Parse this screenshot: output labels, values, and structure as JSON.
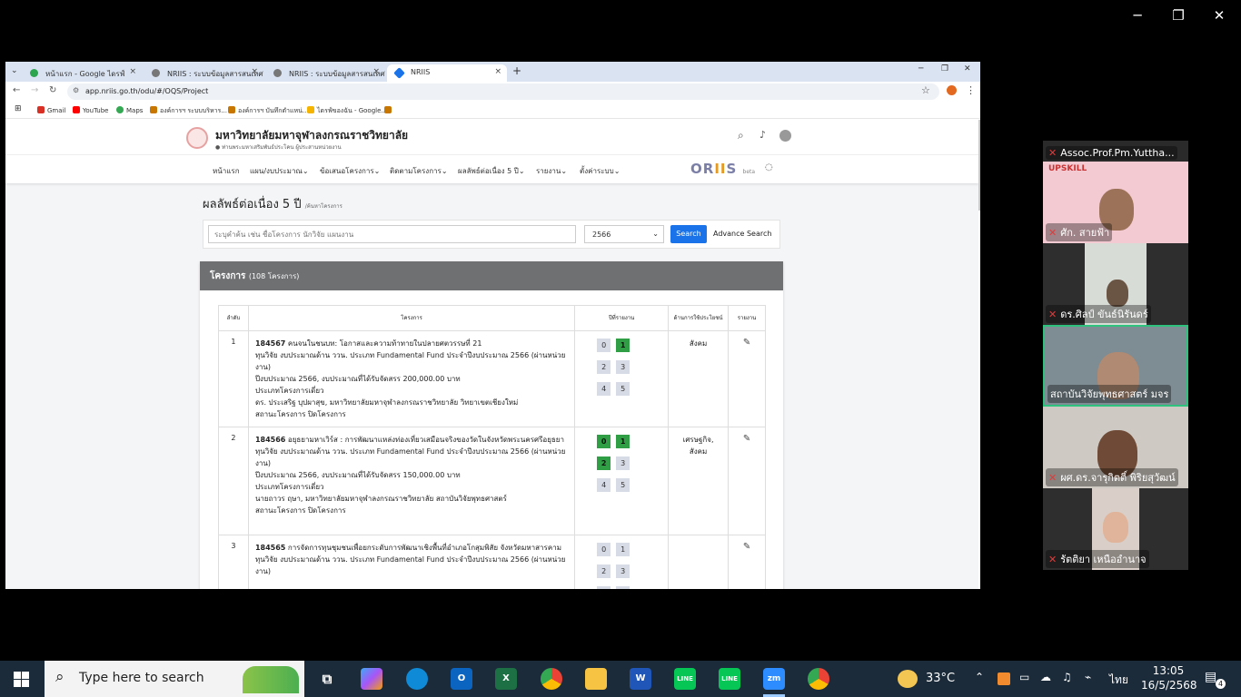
{
  "window_controls": {
    "minimize": "─",
    "restore": "❐",
    "close": "✕"
  },
  "browser": {
    "tabs": [
      {
        "title": "หน้าแรก - Google ไดรฟ์",
        "close": "×",
        "color": "#2da44e"
      },
      {
        "title": "NRIIS : ระบบข้อมูลสารสนเทศวิจัยและ...",
        "close": "×",
        "color": "#555"
      },
      {
        "title": "NRIIS : ระบบข้อมูลสารสนเทศวิจัยและ...",
        "close": "×",
        "color": "#555"
      },
      {
        "title": "NRIIS",
        "close": "×",
        "color": "#1a73e8"
      }
    ],
    "new_tab": "+",
    "tab_menu": "⌄",
    "url": "app.nriis.go.th/odu/#/OQS/Project",
    "bookmarks": [
      {
        "label": "Gmail",
        "color": "#d93025"
      },
      {
        "label": "YouTube",
        "color": "#ff0000"
      },
      {
        "label": "Maps",
        "color": "#34a853"
      },
      {
        "label": "องค์การฯ ระบบบริหาร...",
        "color": "#c77700"
      },
      {
        "label": "องค์การฯ บันทึกตำแหน่...",
        "color": "#c77700"
      },
      {
        "label": "ไดรฟ์ของฉัน - Google...",
        "color": "#f4b400"
      },
      {
        "label": "",
        "color": "#c77700"
      }
    ]
  },
  "site": {
    "university": "มหาวิทยาลัยมหาจุฬาลงกรณราชวิทยาลัย",
    "user_note": "ท่านพระมหาเสริมพันธ์ประโคน ผู้ประสานหน่วยงาน",
    "nav": [
      "หน้าแรก",
      "แผน/งบประมาณ",
      "ข้อเสนอโครงการ",
      "ติดตามโครงการ",
      "ผลลัพธ์ต่อเนื่อง 5 ปี",
      "รายงาน",
      "ตั้งค่าระบบ"
    ],
    "brand": {
      "a": "OR",
      "b": "II",
      "c": "S",
      "beta": "beta"
    },
    "page_title": "ผลลัพธ์ต่อเนื่อง 5 ปี",
    "page_sub": "/ค้นหาโครงการ",
    "search": {
      "placeholder": "ระบุคำค้น เช่น ชื่อโครงการ นักวิจัย แผนงาน",
      "year": "2566",
      "button": "Search",
      "advance": "Advance Search"
    },
    "panel": {
      "title": "โครงการ",
      "count": "(108 โครงการ)"
    },
    "table": {
      "headers": {
        "no": "ลำดับ",
        "project": "โครงการ",
        "year": "ปีที่รายงาน",
        "benefit": "ด้านการใช้ประโยชน์",
        "report": "รายงาน"
      },
      "rows": [
        {
          "no": "1",
          "code": "184567",
          "title": "คนจนในชนบท: โอกาสและความท้าทายในปลายศตวรรษที่ 21",
          "fund": "ทุนวิจัย งบประมาณด้าน ววน. ประเภท Fundamental Fund ประจำปีงบประมาณ 2566 (ผ่านหน่วยงาน)",
          "budget": "ปีงบประมาณ 2566, งบประมาณที่ได้รับจัดสรร 200,000.00 บาท",
          "type": "ประเภทโครงการเดี่ยว",
          "researcher": "ดร. ประเสริฐ บุปผาสุข, มหาวิทยาลัยมหาจุฬาลงกรณราชวิทยาลัย วิทยาเขตเชียงใหม่",
          "status": "สถานะโครงการ ปิดโครงการ",
          "years": [
            {
              "label": "0",
              "on": false
            },
            {
              "label": "1",
              "on": true
            },
            {
              "label": "2",
              "on": false
            },
            {
              "label": "3",
              "on": false
            },
            {
              "label": "4",
              "on": false
            },
            {
              "label": "5",
              "on": false
            }
          ],
          "benefit": "สังคม"
        },
        {
          "no": "2",
          "code": "184566",
          "title": "อยุธยามหาเวิร์ส : การพัฒนาแหล่งท่องเที่ยวเสมือนจริงของวัดในจังหวัดพระนครศรีอยุธยา",
          "fund": "ทุนวิจัย งบประมาณด้าน ววน. ประเภท Fundamental Fund ประจำปีงบประมาณ 2566 (ผ่านหน่วยงาน)",
          "budget": "ปีงบประมาณ 2566, งบประมาณที่ได้รับจัดสรร 150,000.00 บาท",
          "type": "ประเภทโครงการเดี่ยว",
          "researcher": "นายถาวร ฤษา, มหาวิทยาลัยมหาจุฬาลงกรณราชวิทยาลัย สถาบันวิจัยพุทธศาสตร์",
          "status": "สถานะโครงการ ปิดโครงการ",
          "years": [
            {
              "label": "0",
              "on": true
            },
            {
              "label": "1",
              "on": true
            },
            {
              "label": "2",
              "on": true
            },
            {
              "label": "3",
              "on": false
            },
            {
              "label": "4",
              "on": false
            },
            {
              "label": "5",
              "on": false
            }
          ],
          "benefit": "เศรษฐกิจ, สังคม"
        },
        {
          "no": "3",
          "code": "184565",
          "title": "การจัดการทุนชุมชนเพื่อยกระดับการพัฒนาเชิงพื้นที่อำเภอโกสุมพิสัย จังหวัดมหาสารคาม",
          "fund": "ทุนวิจัย งบประมาณด้าน ววน. ประเภท Fundamental Fund ประจำปีงบประมาณ 2566 (ผ่านหน่วยงาน)",
          "budget": "",
          "type": "",
          "researcher": "",
          "status": "",
          "years": [
            {
              "label": "0",
              "on": false
            },
            {
              "label": "1",
              "on": false
            },
            {
              "label": "2",
              "on": false
            },
            {
              "label": "3",
              "on": false
            },
            {
              "label": "4",
              "on": false
            },
            {
              "label": "5",
              "on": false
            }
          ],
          "benefit": ""
        }
      ]
    }
  },
  "video_call": [
    {
      "name": "Assoc.Prof.Pm.Yuttha...",
      "bg": "#000000"
    },
    {
      "name": "ศัก. สายฟ้า",
      "bg": "#f3c9d2",
      "banner": "UPSKILL"
    },
    {
      "name": "ดร.ศิลป์ ขันธ์นิรันดร์",
      "bg": "#2e2e2e"
    },
    {
      "name": "สถาบันวิจัยพุทธศาสตร์ มจร",
      "bg": "#7e8c93"
    },
    {
      "name": "ผศ.ดร.จารุกิตติ์ พิริยสุวัฒน์",
      "bg": "#cfc9c4"
    },
    {
      "name": "รัตติยา เหนืออำนาจ",
      "bg": "#2e2e2e"
    }
  ],
  "taskbar": {
    "search_placeholder": "Type here to search",
    "temperature": "33°C",
    "lang": "ไทย",
    "time": "13:05",
    "date": "16/5/2568",
    "notifications": "4"
  }
}
